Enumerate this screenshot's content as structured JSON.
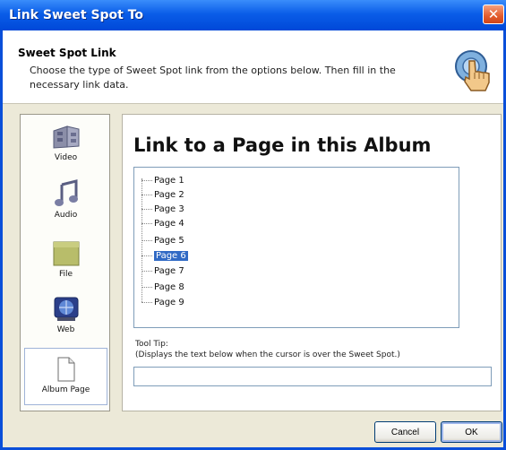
{
  "window": {
    "title": "Link Sweet Spot To",
    "close_glyph": "✕"
  },
  "header": {
    "title": "Sweet Spot Link",
    "description": "Choose the type of Sweet Spot link from the options below. Then fill in the necessary link data.",
    "icon": "hand-pointer-icon"
  },
  "sidebar": {
    "items": [
      {
        "label": "Video",
        "icon": "film-icon"
      },
      {
        "label": "Audio",
        "icon": "music-note-icon"
      },
      {
        "label": "File",
        "icon": "folder-icon"
      },
      {
        "label": "Web",
        "icon": "globe-icon"
      },
      {
        "label": "Album Page",
        "icon": "page-icon",
        "selected": true
      }
    ]
  },
  "main": {
    "title": "Link to a Page in this Album",
    "pages": [
      "Page 1",
      "Page 2",
      "Page 3",
      "Page 4",
      "Page 5",
      "Page 6",
      "Page 7",
      "Page 8",
      "Page 9"
    ],
    "selected_page": "Page 6",
    "tooltip_label": "Tool Tip:",
    "tooltip_hint": "(Displays the text below when the cursor is over the Sweet Spot.)",
    "tooltip_value": ""
  },
  "buttons": {
    "cancel": "Cancel",
    "ok": "OK"
  },
  "colors": {
    "titlebar": "#0a5de8",
    "selection": "#316ac5",
    "dialog_bg": "#ece9d8"
  }
}
